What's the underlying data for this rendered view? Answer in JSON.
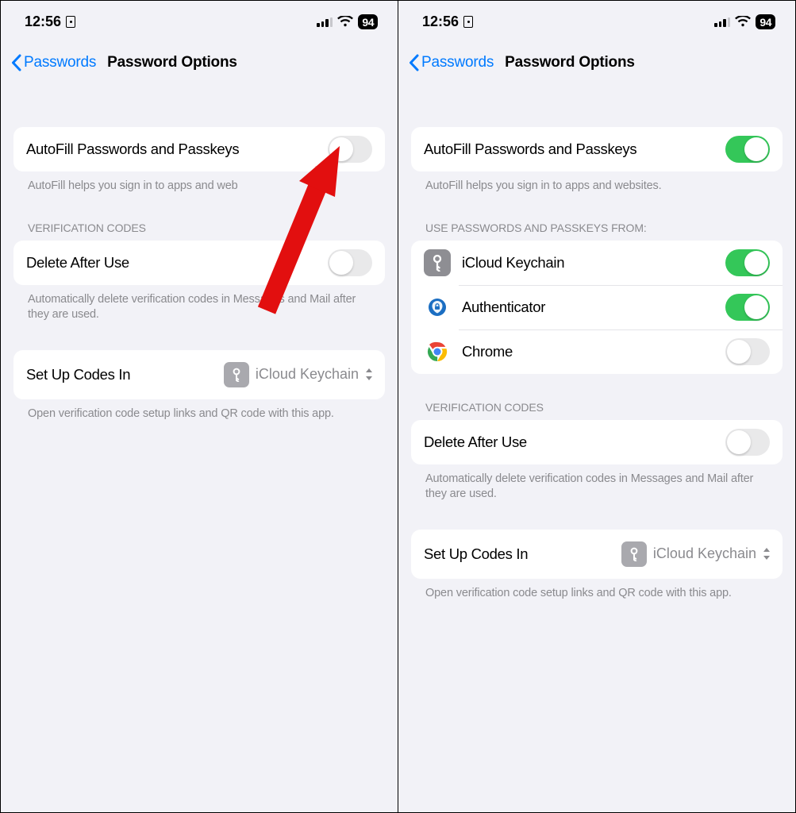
{
  "status": {
    "time": "12:56",
    "battery": "94"
  },
  "nav": {
    "back": "Passwords",
    "title": "Password Options"
  },
  "left": {
    "autofill": {
      "label": "AutoFill Passwords and Passkeys",
      "footer": "AutoFill helps you sign in to apps and web"
    },
    "verification": {
      "header": "Verification Codes",
      "delete_label": "Delete After Use",
      "footer": "Automatically delete verification codes in Messages and Mail after they are used."
    },
    "setup": {
      "label": "Set Up Codes In",
      "value": "iCloud Keychain",
      "footer": "Open verification code setup links and QR code with this app."
    }
  },
  "right": {
    "autofill": {
      "label": "AutoFill Passwords and Passkeys",
      "footer": "AutoFill helps you sign in to apps and websites."
    },
    "providers": {
      "header": "Use Passwords and Passkeys From:",
      "items": [
        {
          "name": "iCloud Keychain",
          "icon": "keychain",
          "on": true
        },
        {
          "name": "Authenticator",
          "icon": "auth",
          "on": true
        },
        {
          "name": "Chrome",
          "icon": "chrome",
          "on": false
        }
      ]
    },
    "verification": {
      "header": "Verification Codes",
      "delete_label": "Delete After Use",
      "footer": "Automatically delete verification codes in Messages and Mail after they are used."
    },
    "setup": {
      "label": "Set Up Codes In",
      "value": "iCloud Keychain",
      "footer": "Open verification code setup links and QR code with this app."
    }
  }
}
